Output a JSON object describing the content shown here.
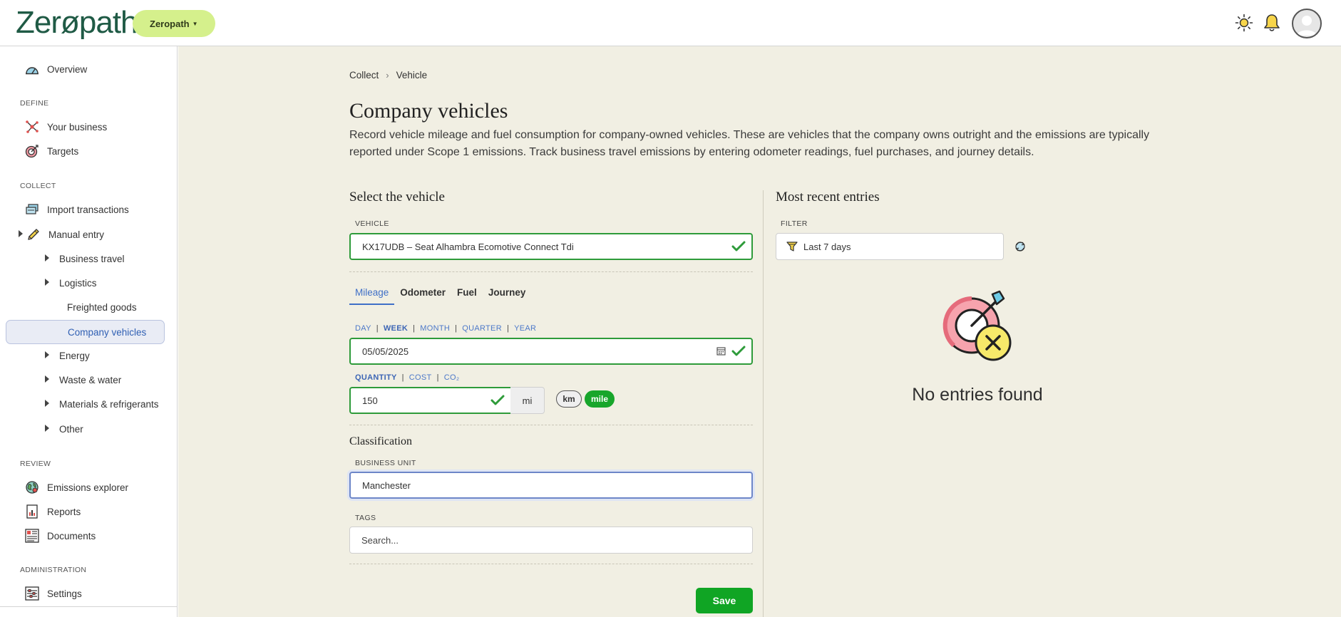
{
  "header": {
    "logo": "Zerøpath",
    "org_button": "Zeropath"
  },
  "sidebar": {
    "overview": "Overview",
    "sections": {
      "define": "DEFINE",
      "collect": "COLLECT",
      "review": "REVIEW",
      "administration": "ADMINISTRATION"
    },
    "define_items": [
      "Your business",
      "Targets"
    ],
    "collect_items": {
      "import": "Import transactions",
      "manual": "Manual entry",
      "business_travel": "Business travel",
      "logistics": "Logistics",
      "freighted_goods": "Freighted goods",
      "company_vehicles": "Company vehicles",
      "energy": "Energy",
      "waste_water": "Waste & water",
      "materials": "Materials & refrigerants",
      "other": "Other"
    },
    "review_items": [
      "Emissions explorer",
      "Reports",
      "Documents"
    ],
    "admin_items": [
      "Settings"
    ]
  },
  "main": {
    "breadcrumb": [
      "Collect",
      "Vehicle"
    ],
    "title": "Company vehicles",
    "description": "Record vehicle mileage and fuel consumption for company-owned vehicles. These are vehicles that the company owns outright and the emissions are typically reported under Scope 1 emissions. Track business travel emissions by entering odometer readings, fuel purchases, and journey details.",
    "form": {
      "section_title": "Select the vehicle",
      "vehicle_label": "VEHICLE",
      "vehicle_value": "KX17UDB – Seat Alhambra Ecomotive Connect Tdi",
      "tabs": [
        "Mileage",
        "Odometer",
        "Fuel",
        "Journey"
      ],
      "active_tab": "Mileage",
      "period_options": [
        "DAY",
        "WEEK",
        "MONTH",
        "QUARTER",
        "YEAR"
      ],
      "period_selected": "WEEK",
      "date_value": "05/05/2025",
      "measure_options": [
        "QUANTITY",
        "COST",
        "CO₂"
      ],
      "measure_selected": "QUANTITY",
      "quantity_value": "150",
      "unit_addon": "mi",
      "unit_km": "km",
      "unit_mile": "mile",
      "unit_selected": "mile",
      "classification_title": "Classification",
      "business_unit_label": "BUSINESS UNIT",
      "business_unit_value": "Manchester",
      "tags_label": "TAGS",
      "tags_placeholder": "Search...",
      "save_label": "Save"
    },
    "recent": {
      "title": "Most recent entries",
      "filter_label": "FILTER",
      "filter_value": "Last 7 days",
      "empty_text": "No entries found"
    }
  },
  "colors": {
    "accent_green": "#10a524",
    "brand_lime": "#d5f08c",
    "link_blue": "#3f6fc7",
    "main_bg": "#f1efe3"
  }
}
